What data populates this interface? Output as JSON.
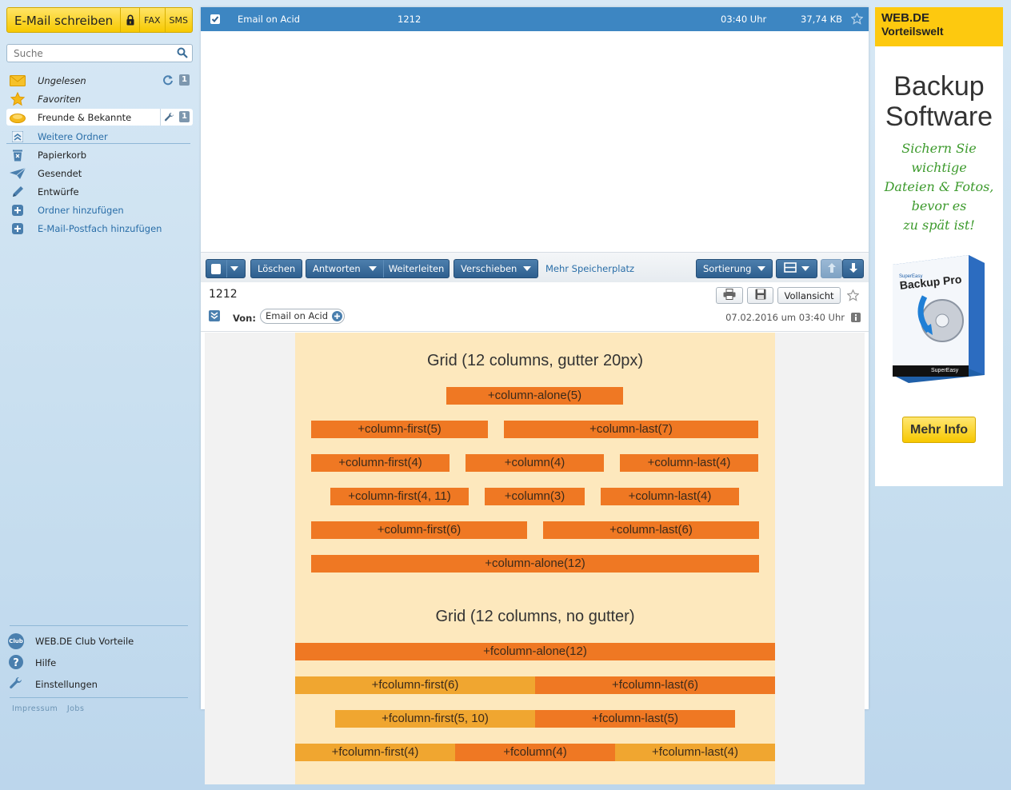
{
  "compose": {
    "label": "E-Mail schreiben",
    "fax": "FAX",
    "sms": "SMS"
  },
  "search": {
    "placeholder": "Suche"
  },
  "sidebar": {
    "items": [
      {
        "label": "Ungelesen",
        "badge": "1"
      },
      {
        "label": "Favoriten"
      },
      {
        "label": "Freunde & Bekannte",
        "badge": "1"
      },
      {
        "label": "Weitere Ordner"
      },
      {
        "label": "Papierkorb"
      },
      {
        "label": "Gesendet"
      },
      {
        "label": "Entwürfe"
      },
      {
        "label": "Ordner hinzufügen"
      },
      {
        "label": "E-Mail-Postfach hinzufügen"
      }
    ],
    "bottom": [
      {
        "label": "WEB.DE Club Vorteile",
        "icon_text": "Club"
      },
      {
        "label": "Hilfe"
      },
      {
        "label": "Einstellungen"
      }
    ],
    "footer": [
      "Impressum",
      "Jobs"
    ]
  },
  "maillist": {
    "row": {
      "sender": "Email on Acid",
      "subject": "1212",
      "time": "03:40 Uhr",
      "size": "37,74 KB"
    }
  },
  "toolbar": {
    "delete": "Löschen",
    "reply": "Antworten",
    "forward": "Weiterleiten",
    "move": "Verschieben",
    "more_storage": "Mehr Speicherplatz",
    "sort": "Sortierung"
  },
  "message": {
    "subject": "1212",
    "fullview": "Vollansicht",
    "from_label": "Von:",
    "from": "Email on Acid",
    "date": "07.02.2016 um 03:40 Uhr"
  },
  "email_body": {
    "title1": "Grid (12 columns, gutter 20px)",
    "title2": "Grid (12 columns, no gutter)",
    "cells": [
      "+column-alone(5)",
      "+column-first(5)",
      "+column-last(7)",
      "+column-first(4)",
      "+column(4)",
      "+column-last(4)",
      "+column-first(4, 11)",
      "+column(3)",
      "+column-last(4)",
      "+column-first(6)",
      "+column-last(6)",
      "+column-alone(12)",
      "+fcolumn-alone(12)",
      "+fcolumn-first(6)",
      "+fcolumn-last(6)",
      "+fcolumn-first(5, 10)",
      "+fcolumn-last(5)",
      "+fcolumn-first(4)",
      "+fcolumn(4)",
      "+fcolumn-last(4)"
    ]
  },
  "ad": {
    "brand": "WEB.DE",
    "subtitle": "Vorteilswelt",
    "title_line1": "Backup",
    "title_line2": "Software",
    "text_lines": [
      "Sichern Sie",
      "wichtige",
      "Dateien & Fotos,",
      "bevor es",
      "zu spät ist!"
    ],
    "product_small": "SuperEasy",
    "product": "Backup Pro",
    "product_brand": "SuperEasy",
    "button": "Mehr Info"
  },
  "colors": {
    "accent_blue": "#3d86c2",
    "brand_yellow": "#fdc90f",
    "grid_dark": "#ef7823",
    "grid_light": "#f0a630",
    "grid_bg": "#fde8bd"
  }
}
